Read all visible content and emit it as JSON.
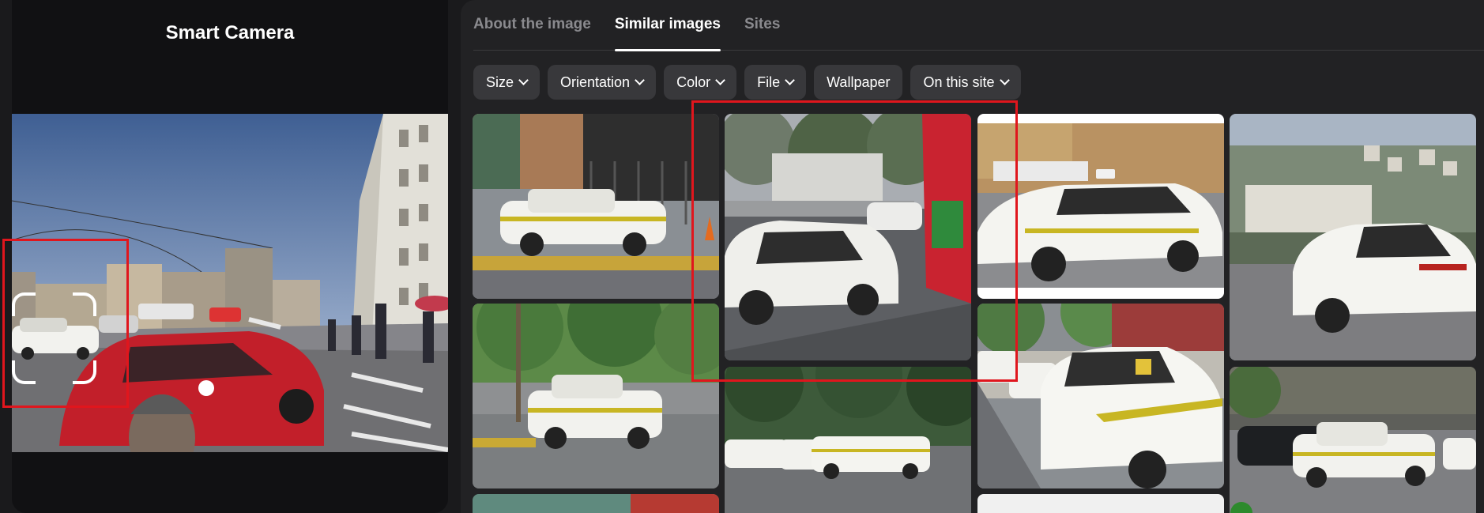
{
  "left_panel": {
    "title": "Smart Camera"
  },
  "tabs": [
    {
      "label": "About the image",
      "active": false
    },
    {
      "label": "Similar images",
      "active": true
    },
    {
      "label": "Sites",
      "active": false
    }
  ],
  "filters": [
    {
      "label": "Size",
      "dropdown": true
    },
    {
      "label": "Orientation",
      "dropdown": true
    },
    {
      "label": "Color",
      "dropdown": true
    },
    {
      "label": "File",
      "dropdown": true
    },
    {
      "label": "Wallpaper",
      "dropdown": false
    },
    {
      "label": "On this site",
      "dropdown": true
    }
  ],
  "colors": {
    "background": "#1a1a1c",
    "left_panel": "#111113",
    "right_panel": "#222224",
    "chip": "#38383b",
    "highlight": "#e0161d",
    "taxi_white": "#f2f2ee",
    "taxi_stripe": "#c8b623",
    "red_car": "#c21f2a"
  },
  "icons": {
    "chip_dropdown": "chevron-down-icon",
    "scan_frame": "scan-frame-icon"
  }
}
